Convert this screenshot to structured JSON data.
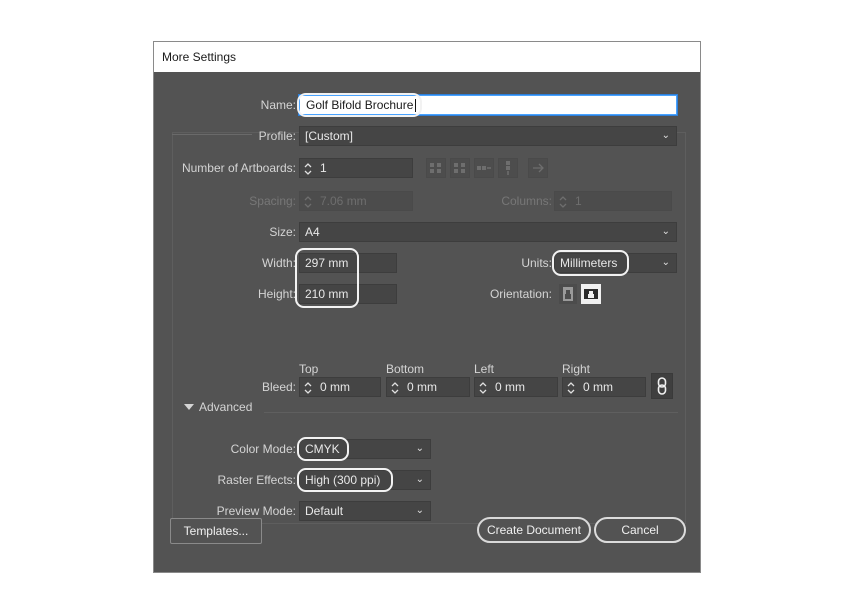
{
  "dialog": {
    "title": "More Settings"
  },
  "name": {
    "label": "Name:",
    "value": "Golf Bifold Brochure"
  },
  "profile": {
    "label": "Profile:",
    "value": "[Custom]"
  },
  "artboards": {
    "label": "Number of Artboards:",
    "value": "1"
  },
  "spacing": {
    "label": "Spacing:",
    "value": "7.06 mm"
  },
  "columns": {
    "label": "Columns:",
    "value": "1"
  },
  "size": {
    "label": "Size:",
    "value": "A4"
  },
  "width": {
    "label": "Width:",
    "value": "297 mm"
  },
  "height": {
    "label": "Height:",
    "value": "210 mm"
  },
  "units": {
    "label": "Units:",
    "value": "Millimeters"
  },
  "orientation": {
    "label": "Orientation:",
    "selected": "landscape"
  },
  "bleed": {
    "label": "Bleed:",
    "top": {
      "label": "Top",
      "value": "0 mm"
    },
    "bottom": {
      "label": "Bottom",
      "value": "0 mm"
    },
    "left": {
      "label": "Left",
      "value": "0 mm"
    },
    "right": {
      "label": "Right",
      "value": "0 mm"
    },
    "link_icon": "chain-link-icon"
  },
  "advanced": {
    "label": "Advanced",
    "color_mode": {
      "label": "Color Mode:",
      "value": "CMYK"
    },
    "raster_effects": {
      "label": "Raster Effects:",
      "value": "High (300 ppi)"
    },
    "preview_mode": {
      "label": "Preview Mode:",
      "value": "Default"
    }
  },
  "buttons": {
    "templates": "Templates...",
    "create": "Create Document",
    "cancel": "Cancel"
  },
  "colors": {
    "dialog_bg": "#535353",
    "field_bg": "#454545",
    "focus": "#49a3ff"
  }
}
